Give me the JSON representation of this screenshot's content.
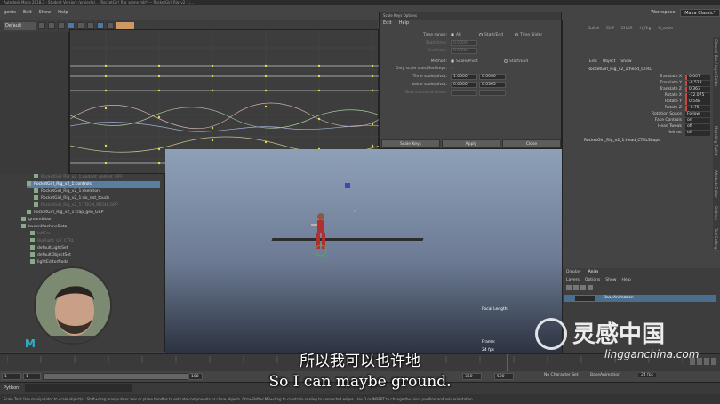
{
  "window": {
    "title": "Autodesk Maya 2018.3 - Student Version: /projects/... /RocketGirl_Rig_scene.mb*  ---  RocketGirl_Rig_v2_1:..."
  },
  "menubar": {
    "items": [
      "gents",
      "Edit",
      "Show",
      "Help"
    ],
    "workspace_label": "Workspace:",
    "workspace_value": "Maya Classic*"
  },
  "statusline": {
    "mode": "Default"
  },
  "scale_keys": {
    "window_title": "Scale Keys Options",
    "menu": [
      "Edit",
      "Help"
    ],
    "time_range_label": "Time range:",
    "time_range_options": [
      "All",
      "Start/End",
      "Time Slider"
    ],
    "start_time_label": "Start time:",
    "start_time_value": "0.0000",
    "end_time_label": "End time:",
    "end_time_value": "0.0000",
    "method_label": "Method:",
    "method_options": [
      "Scale/Pivot",
      "Start/End"
    ],
    "only_scale_label": "Only scale specified keys:",
    "time_scale_label": "Time scale/pivot:",
    "time_scale_value": "1.0000",
    "time_pivot_value": "0.0000",
    "value_scale_label": "Value scale/pivot:",
    "value_scale_value": "0.0000",
    "value_pivot_value": "0.0365",
    "new_start_label": "New start/end times:",
    "buttons": [
      "Scale Keys",
      "Apply",
      "Close"
    ]
  },
  "channel_box": {
    "tabs": [
      "Bullet",
      "Cliff",
      "CHAR",
      "H_Rig",
      "H_anim"
    ],
    "menu": [
      "Edit",
      "Object",
      "Show"
    ],
    "node": "RocketGirl_Rig_v2_1:head_CTRL",
    "attributes": [
      {
        "name": "Translate X",
        "value": "0.007"
      },
      {
        "name": "Translate Y",
        "value": "-0.528"
      },
      {
        "name": "Translate Z",
        "value": "0.363"
      },
      {
        "name": "Rotate X",
        "value": "-12.075"
      },
      {
        "name": "Rotate Y",
        "value": "0.548"
      },
      {
        "name": "Rotate Z",
        "value": "-0.75"
      },
      {
        "name": "Rotation Space",
        "value": "Follow"
      },
      {
        "name": "Face Controls",
        "value": "on"
      },
      {
        "name": "Head Tweak",
        "value": "off"
      },
      {
        "name": "Helmet",
        "value": "off"
      }
    ],
    "shape_node": "RocketGirl_Rig_v2_1:head_CTRLShape",
    "side_tabs": [
      "Channel Box / Layer Editor",
      "Modelling Toolkit",
      "Attribute Editor",
      "Outliner",
      "Tool Settings"
    ]
  },
  "layer_editor": {
    "tabs": [
      "Display",
      "Anim"
    ],
    "menu": [
      "Layers",
      "Options",
      "Show",
      "Help"
    ],
    "layer": "BaseAnimation"
  },
  "outliner": {
    "items": [
      "RocketGirl_Rig_v2_1:gadget_gadget_OFF",
      "RocketGirl_Rig_v2_1:controls",
      "RocketGirl_Rig_v2_1:skeleton",
      "RocketGirl_Rig_v2_1:do_not_touch",
      "RocketGirl_Rig_v2_1:TOON_MESH_GRP",
      "RocketGirl_Rig_v2_1:trap_geo_GRP",
      "groundfloor",
      "tweenMachineData",
      "leftEar",
      "BigRight_UV_CTRL",
      "defaultLightSet",
      "defaultObjectSet",
      "lightEditorNode"
    ]
  },
  "viewport": {
    "focal_label": "Focal Length:",
    "frame_label": "Frame:",
    "fps_label": "24 fps"
  },
  "timeline": {
    "start_field": "1",
    "start_field2": "1",
    "current_frame": "108",
    "end_field": "350",
    "end_field2": "500",
    "character_set": "No Character Set",
    "anim_layer": "BaseAnimation",
    "fps": "24 fps"
  },
  "cmdline": {
    "lang": "Python"
  },
  "helpline": {
    "text": "Scale Tool: Use manipulator to scale object(s). Shift+drag manipulator axis or plane handles to extrude components or clone objects. Ctrl+Shift+LMB+drag to constrain scaling to connected edges. Use D or INSERT to change the pivot position and axis orientation."
  },
  "subtitles": {
    "cn": "所以我可以也许地",
    "en": "So I can maybe ground."
  },
  "watermark": {
    "cn": "灵感中国",
    "url": "lingganchina.com"
  }
}
